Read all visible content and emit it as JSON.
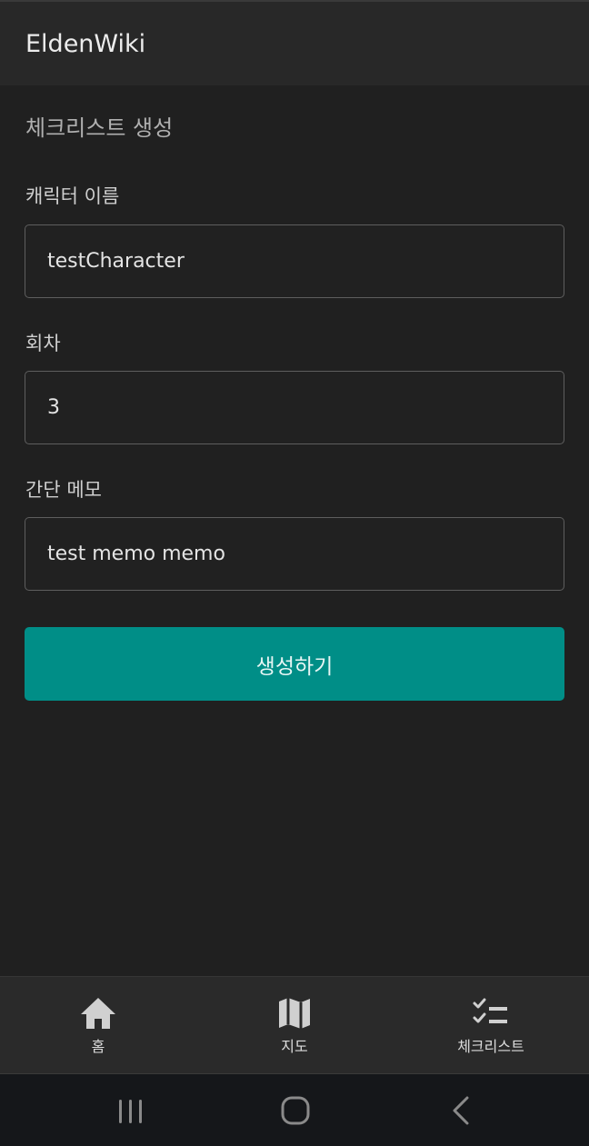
{
  "app": {
    "title": "EldenWiki"
  },
  "page": {
    "title": "체크리스트 생성"
  },
  "form": {
    "character_name": {
      "label": "캐릭터 이름",
      "value": "testCharacter"
    },
    "playthrough": {
      "label": "회차",
      "value": "3"
    },
    "memo": {
      "label": "간단 메모",
      "value": "test memo memo"
    },
    "submit_label": "생성하기"
  },
  "bottom_nav": {
    "items": [
      {
        "label": "홈",
        "icon": "home-icon"
      },
      {
        "label": "지도",
        "icon": "map-icon"
      },
      {
        "label": "체크리스트",
        "icon": "checklist-icon"
      }
    ]
  },
  "system_nav": {
    "buttons": [
      "recent-apps-icon",
      "home-circle-icon",
      "back-icon"
    ]
  },
  "colors": {
    "background": "#202020",
    "app_bar": "#282828",
    "accent": "#008e87",
    "bottom_nav": "#2a2a2a",
    "system_bar": "#15171a"
  }
}
